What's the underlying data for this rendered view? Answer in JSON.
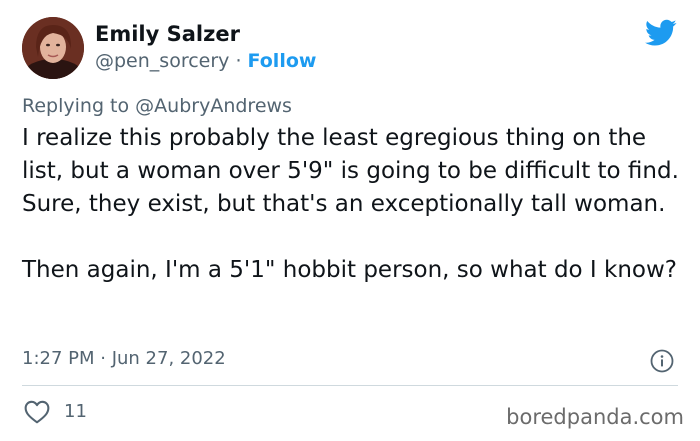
{
  "author": {
    "name": "Emily Salzer",
    "handle": "@pen_sorcery",
    "separator": "·",
    "follow_label": "Follow"
  },
  "reply": {
    "prefix": "Replying to",
    "mention": "@AubryAndrews"
  },
  "tweet": {
    "paragraph_1": "I realize this probably the least egregious thing on the list, but a woman over 5'9\" is going to be difficult to find. Sure, they exist, but that's an exceptionally tall woman.",
    "paragraph_2": "Then again, I'm a 5'1\" hobbit person, so what do I know?"
  },
  "meta": {
    "timestamp": "1:27 PM · Jun 27, 2022"
  },
  "actions": {
    "like_count": "11"
  },
  "watermark": "boredpanda.com",
  "icons": {
    "brand": "twitter-bird-icon",
    "info": "info-icon",
    "like": "heart-icon"
  },
  "colors": {
    "accent": "#1d9bf0",
    "text": "#0f1419",
    "secondary": "#536471",
    "divider": "#cfd9de"
  }
}
